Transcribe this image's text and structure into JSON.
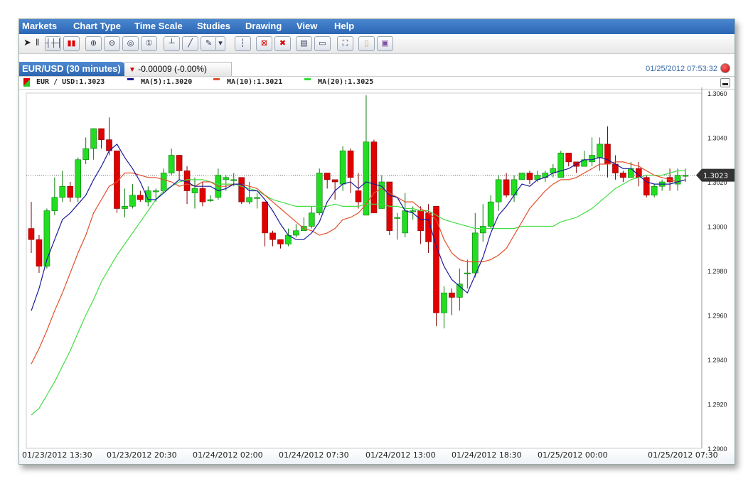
{
  "menu": [
    "Markets",
    "Chart Type",
    "Time Scale",
    "Studies",
    "Drawing",
    "View",
    "Help"
  ],
  "toolbar": [
    {
      "name": "pointer-icon",
      "glyph": "➤"
    },
    {
      "name": "separator-icon",
      "glyph": "‖"
    },
    {
      "name": "bar-chart-icon",
      "glyph": "┤┼┤"
    },
    {
      "name": "candlestick-chart-icon",
      "glyph": "▮▮"
    },
    {
      "name": "zoom-in-icon",
      "glyph": "⊕"
    },
    {
      "name": "zoom-out-icon",
      "glyph": "⊖"
    },
    {
      "name": "zoom-fit-icon",
      "glyph": "◎"
    },
    {
      "name": "zoom-reset-icon",
      "glyph": "①"
    },
    {
      "name": "horizontal-line-icon",
      "glyph": "┴"
    },
    {
      "name": "trend-line-icon",
      "glyph": "╱"
    },
    {
      "name": "pencil-icon",
      "glyph": "✎"
    },
    {
      "name": "dropdown-arrow-icon",
      "glyph": "▾"
    },
    {
      "name": "crosshair-icon",
      "glyph": "┆"
    },
    {
      "name": "delete-selected-icon",
      "glyph": "⊠"
    },
    {
      "name": "delete-all-icon",
      "glyph": "✖"
    },
    {
      "name": "print-icon",
      "glyph": "▤"
    },
    {
      "name": "image-export-icon",
      "glyph": "▭"
    },
    {
      "name": "fullscreen-icon",
      "glyph": "⛶"
    },
    {
      "name": "open-icon",
      "glyph": "▯"
    },
    {
      "name": "save-icon",
      "glyph": "▣"
    }
  ],
  "tab": {
    "title": "EUR/USD (30 minutes)",
    "change": "-0.00009 (-0.00%)",
    "direction": "down"
  },
  "timestamp": "01/25/2012 07:53:32",
  "legend": [
    {
      "label": "EUR / USD:1.3023",
      "color": "#e00000"
    },
    {
      "label": "MA(5):1.3020",
      "color": "#1a1a9a"
    },
    {
      "label": "MA(10):1.3021",
      "color": "#e2502a"
    },
    {
      "label": "MA(20):1.3025",
      "color": "#33dd33"
    }
  ],
  "chart_data": {
    "type": "candlestick",
    "symbol": "EUR/USD",
    "interval": "30 minutes",
    "ylim": [
      1.29,
      1.306
    ],
    "yticks": [
      "1.3060",
      "1.3040",
      "1.3020",
      "1.3000",
      "1.2980",
      "1.2960",
      "1.2940",
      "1.2920",
      "1.2900"
    ],
    "xticks": [
      "01/23/2012 13:30",
      "01/23/2012 20:30",
      "01/24/2012 02:00",
      "01/24/2012 07:30",
      "01/24/2012 13:00",
      "01/24/2012 18:30",
      "01/25/2012 00:00",
      "01/25/2012 07:30"
    ],
    "last_price": "1.3023",
    "last_price_value": 1.3023,
    "colors": {
      "up": "#22dd22",
      "down": "#e00000",
      "ma5": "#1a1a9a",
      "ma10": "#e2502a",
      "ma20": "#44dd44"
    },
    "candles": [
      [
        1.2999,
        1.2994,
        1.3011,
        1.2988
      ],
      [
        1.2994,
        1.2982,
        1.2996,
        1.2979
      ],
      [
        1.2982,
        1.3007,
        1.3008,
        1.2981
      ],
      [
        1.3007,
        1.3013,
        1.3022,
        1.3005
      ],
      [
        1.3013,
        1.3018,
        1.3025,
        1.3011
      ],
      [
        1.3018,
        1.3013,
        1.302,
        1.3011
      ],
      [
        1.3013,
        1.303,
        1.3031,
        1.3011
      ],
      [
        1.303,
        1.3035,
        1.304,
        1.3028
      ],
      [
        1.3035,
        1.3044,
        1.3044,
        1.303
      ],
      [
        1.3044,
        1.3039,
        1.3044,
        1.3035
      ],
      [
        1.3039,
        1.3034,
        1.3049,
        1.3032
      ],
      [
        1.3034,
        1.3008,
        1.3033,
        1.3006
      ],
      [
        1.3008,
        1.3009,
        1.3017,
        1.3004
      ],
      [
        1.3009,
        1.3014,
        1.3019,
        1.3008
      ],
      [
        1.3014,
        1.3012,
        1.3016,
        1.3011
      ],
      [
        1.3011,
        1.3016,
        1.3018,
        1.3009
      ],
      [
        1.3016,
        1.3016,
        1.3017,
        1.3011
      ],
      [
        1.3016,
        1.3024,
        1.3026,
        1.3015
      ],
      [
        1.3024,
        1.3032,
        1.3035,
        1.3023
      ],
      [
        1.3032,
        1.3025,
        1.3032,
        1.3021
      ],
      [
        1.3025,
        1.3016,
        1.3027,
        1.301
      ],
      [
        1.3015,
        1.3017,
        1.3022,
        1.3008
      ],
      [
        1.3017,
        1.3011,
        1.302,
        1.3009
      ],
      [
        1.3012,
        1.3012,
        1.3014,
        1.3011
      ],
      [
        1.3013,
        1.3023,
        1.3026,
        1.3012
      ],
      [
        1.3021,
        1.3022,
        1.3023,
        1.3016
      ],
      [
        1.3021,
        1.3021,
        1.3024,
        1.3018
      ],
      [
        1.3022,
        1.3011,
        1.3022,
        1.301
      ],
      [
        1.3011,
        1.3013,
        1.302,
        1.301
      ],
      [
        1.3013,
        1.3013,
        1.3015,
        1.3008
      ],
      [
        1.3011,
        1.2997,
        1.3011,
        1.2991
      ],
      [
        1.2997,
        1.2994,
        1.2998,
        1.2991
      ],
      [
        1.2994,
        1.2992,
        1.2994,
        1.299
      ],
      [
        1.2992,
        1.2996,
        1.2999,
        1.2991
      ],
      [
        1.2996,
        1.2998,
        1.3001,
        1.2995
      ],
      [
        1.2998,
        1.3,
        1.3004,
        1.2998
      ],
      [
        1.3,
        1.3006,
        1.3009,
        1.2999
      ],
      [
        1.3006,
        1.3024,
        1.3026,
        1.3005
      ],
      [
        1.3024,
        1.3021,
        1.3024,
        1.3017
      ],
      [
        1.3021,
        1.302,
        1.3021,
        1.3012
      ],
      [
        1.3019,
        1.3034,
        1.3036,
        1.3016
      ],
      [
        1.3034,
        1.3022,
        1.3035,
        1.3015
      ],
      [
        1.3016,
        1.3011,
        1.3024,
        1.3008
      ],
      [
        1.3005,
        1.3038,
        1.3059,
        1.3005
      ],
      [
        1.3038,
        1.3006,
        1.3039,
        1.3008
      ],
      [
        1.3008,
        1.302,
        1.3023,
        1.3013
      ],
      [
        1.302,
        1.2998,
        1.302,
        1.2996
      ],
      [
        1.3004,
        1.3004,
        1.3006,
        1.2994
      ],
      [
        1.2997,
        1.3007,
        1.3015,
        1.2995
      ],
      [
        1.3007,
        1.3007,
        1.3009,
        1.3003
      ],
      [
        1.3007,
        1.2998,
        1.3009,
        1.2992
      ],
      [
        1.3006,
        1.2993,
        1.301,
        1.2988
      ],
      [
        1.3009,
        1.2961,
        1.3009,
        1.2955
      ],
      [
        1.2961,
        1.297,
        1.2973,
        1.2954
      ],
      [
        1.297,
        1.2968,
        1.2972,
        1.296
      ],
      [
        1.2968,
        1.2974,
        1.2981,
        1.2962
      ],
      [
        1.2979,
        1.2979,
        1.2985,
        1.2972
      ],
      [
        1.2979,
        1.2997,
        1.3006,
        1.2977
      ],
      [
        1.2997,
        1.3,
        1.301,
        1.2993
      ],
      [
        1.3,
        1.3011,
        1.3014,
        1.2999
      ],
      [
        1.3011,
        1.3021,
        1.3023,
        1.3007
      ],
      [
        1.3021,
        1.3014,
        1.3024,
        1.3013
      ],
      [
        1.3014,
        1.3021,
        1.3023,
        1.3011
      ],
      [
        1.3021,
        1.3024,
        1.3024,
        1.3021
      ],
      [
        1.3024,
        1.3021,
        1.3025,
        1.3019
      ],
      [
        1.3021,
        1.3023,
        1.3025,
        1.302
      ],
      [
        1.3022,
        1.3024,
        1.3025,
        1.302
      ],
      [
        1.3024,
        1.3026,
        1.3028,
        1.3022
      ],
      [
        1.3022,
        1.3033,
        1.3034,
        1.3022
      ],
      [
        1.3033,
        1.3029,
        1.3033,
        1.3027
      ],
      [
        1.3029,
        1.3027,
        1.3028,
        1.3024
      ],
      [
        1.3027,
        1.303,
        1.3034,
        1.3027
      ],
      [
        1.3029,
        1.3032,
        1.304,
        1.3027
      ],
      [
        1.3031,
        1.3037,
        1.304,
        1.3025
      ],
      [
        1.3037,
        1.3028,
        1.3045,
        1.3022
      ],
      [
        1.3028,
        1.3024,
        1.3032,
        1.3021
      ],
      [
        1.3024,
        1.3022,
        1.3025,
        1.302
      ],
      [
        1.3022,
        1.3026,
        1.3029,
        1.3022
      ],
      [
        1.3026,
        1.3022,
        1.3029,
        1.3018
      ],
      [
        1.3022,
        1.3014,
        1.3023,
        1.3013
      ],
      [
        1.3014,
        1.3018,
        1.3019,
        1.3013
      ],
      [
        1.3018,
        1.302,
        1.3021,
        1.3016
      ],
      [
        1.3022,
        1.302,
        1.3026,
        1.3016
      ],
      [
        1.3019,
        1.3023,
        1.3026,
        1.3016
      ],
      [
        1.3023,
        1.3023,
        1.3026,
        1.302
      ]
    ],
    "ma5": [
      1.2962,
      1.2972,
      1.2985,
      1.2994,
      1.3003,
      1.3006,
      1.301,
      1.3014,
      1.3021,
      1.3027,
      1.3034,
      1.3037,
      1.3031,
      1.3026,
      1.302,
      1.3012,
      1.3012,
      1.3015,
      1.3018,
      1.3021,
      1.302,
      1.3018,
      1.3018,
      1.3018,
      1.3016,
      1.3017,
      1.3019,
      1.3019,
      1.3016,
      1.3016,
      1.3012,
      1.3007,
      1.3001,
      1.2996,
      1.2994,
      1.2994,
      1.2997,
      1.3002,
      1.3011,
      1.3016,
      1.3019,
      1.302,
      1.3017,
      1.302,
      1.3019,
      1.3018,
      1.3014,
      1.3013,
      1.3007,
      1.3006,
      1.3003,
      1.3003,
      1.2991,
      1.2982,
      1.2976,
      1.2973,
      1.297,
      1.2978,
      1.2986,
      1.2997,
      1.3005,
      1.3009,
      1.3014,
      1.3019,
      1.3018,
      1.3021,
      1.3022,
      1.3024,
      1.3025,
      1.3026,
      1.3028,
      1.303,
      1.303,
      1.3031,
      1.303,
      1.3028,
      1.3026,
      1.3026,
      1.3023,
      1.302,
      1.3019,
      1.3019,
      1.3019,
      1.302,
      1.3021
    ],
    "ma10": [
      1.2938,
      1.2945,
      1.2953,
      1.2962,
      1.297,
      1.2979,
      1.2988,
      1.2996,
      1.3006,
      1.3012,
      1.3018,
      1.302,
      1.3024,
      1.3024,
      1.3023,
      1.3022,
      1.3022,
      1.3021,
      1.302,
      1.3018,
      1.3019,
      1.3018,
      1.302,
      1.302,
      1.3018,
      1.3018,
      1.3019,
      1.3019,
      1.3018,
      1.3017,
      1.3014,
      1.3011,
      1.3008,
      1.3005,
      1.3002,
      1.2999,
      1.2998,
      1.2996,
      1.2997,
      1.2999,
      1.3003,
      1.3004,
      1.3006,
      1.301,
      1.3015,
      1.3017,
      1.3015,
      1.3013,
      1.3011,
      1.3011,
      1.3008,
      1.3006,
      1.3003,
      1.2994,
      1.2988,
      1.2985,
      1.2984,
      1.2984,
      1.2984,
      1.2985,
      1.2987,
      1.299,
      1.2996,
      1.3002,
      1.3008,
      1.3012,
      1.3016,
      1.3019,
      1.3021,
      1.3021,
      1.3022,
      1.3024,
      1.3026,
      1.3028,
      1.3028,
      1.3029,
      1.3029,
      1.3028,
      1.3027,
      1.3025,
      1.3023,
      1.3022,
      1.3021,
      1.302,
      1.3021
    ],
    "ma20": [
      1.2915,
      1.2918,
      1.2924,
      1.293,
      1.2937,
      1.2944,
      1.2952,
      1.296,
      1.2967,
      1.2975,
      1.2981,
      1.2987,
      1.2992,
      1.2997,
      1.3002,
      1.3007,
      1.3012,
      1.3016,
      1.3018,
      1.302,
      1.3021,
      1.3021,
      1.3021,
      1.302,
      1.3019,
      1.3019,
      1.3019,
      1.3018,
      1.3017,
      1.3016,
      1.3014,
      1.3012,
      1.3011,
      1.301,
      1.3009,
      1.3009,
      1.3009,
      1.3009,
      1.3009,
      1.301,
      1.3009,
      1.3009,
      1.3009,
      1.301,
      1.301,
      1.301,
      1.3009,
      1.3009,
      1.3008,
      1.3008,
      1.3007,
      1.3007,
      1.3005,
      1.3003,
      1.3002,
      1.3001,
      1.3,
      1.2999,
      1.2999,
      1.2999,
      1.2999,
      1.2999,
      1.2999,
      1.3,
      1.3,
      1.3,
      1.3,
      1.3,
      1.3002,
      1.3003,
      1.3004,
      1.3006,
      1.3008,
      1.3011,
      1.3014,
      1.3017,
      1.3019,
      1.3021,
      1.3022,
      1.3023,
      1.3023,
      1.3023,
      1.3024,
      1.3025,
      1.3025
    ]
  }
}
